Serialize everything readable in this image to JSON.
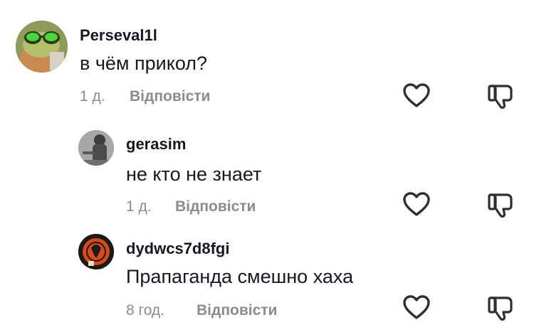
{
  "comments": [
    {
      "username": "Perseval1l",
      "text": "в чём прикол?",
      "time": "1 д.",
      "reply_label": "Відповісти",
      "avatar_icon": "frog-sunglasses-avatar"
    },
    {
      "username": "gerasim",
      "text": "не кто не знает",
      "time": "1 д.",
      "reply_label": "Відповісти",
      "avatar_icon": "grayscale-figure-avatar"
    },
    {
      "username": "dydwcs7d8fgi",
      "text": "Прапаганда смешно хаха",
      "time": "8 год.",
      "reply_label": "Відповісти",
      "avatar_icon": "red-emblem-avatar"
    }
  ],
  "icons": {
    "like": "heart-outline-icon",
    "dislike": "thumbs-down-icon"
  },
  "colors": {
    "text": "#161823",
    "muted": "#8a8b91",
    "icon": "#2f2f33"
  }
}
